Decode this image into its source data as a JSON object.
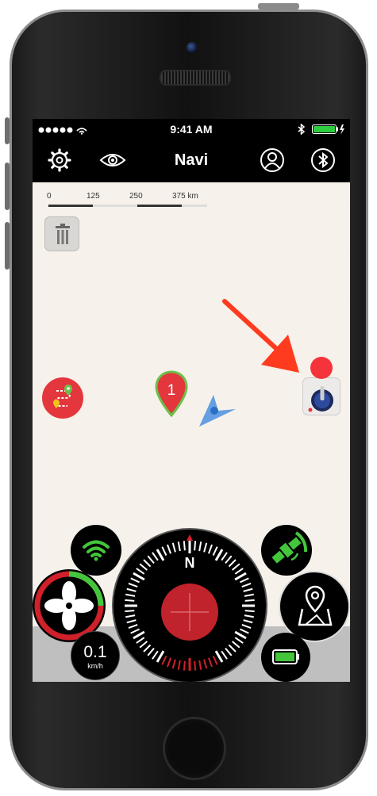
{
  "status_bar": {
    "time": "9:41 AM",
    "signal_icon": "signal-dots-icon",
    "wifi_icon": "wifi-icon",
    "bluetooth_icon": "bluetooth-icon",
    "battery_icon": "battery-charging-icon",
    "battery_color": "#2ecc40"
  },
  "nav_bar": {
    "title": "Navi",
    "left_icons": [
      "gear-icon",
      "eye-icon"
    ],
    "right_icons": [
      "user-icon",
      "bluetooth-icon"
    ]
  },
  "map": {
    "background": "#f6f1ea",
    "scale_labels": [
      "0",
      "125",
      "250",
      "375 km"
    ],
    "waypoint_label": "1",
    "waypoint_color": "#e4363d",
    "waypoint_outline": "#6cc04a",
    "position_arrow_color": "#4a90e2",
    "annotation_arrow_color": "#ff3b1f"
  },
  "controls": {
    "speed_value": "0.1",
    "speed_unit": "km/h",
    "compass_letter": "N",
    "accent_red": "#d0202a",
    "accent_green": "#43c63b"
  }
}
